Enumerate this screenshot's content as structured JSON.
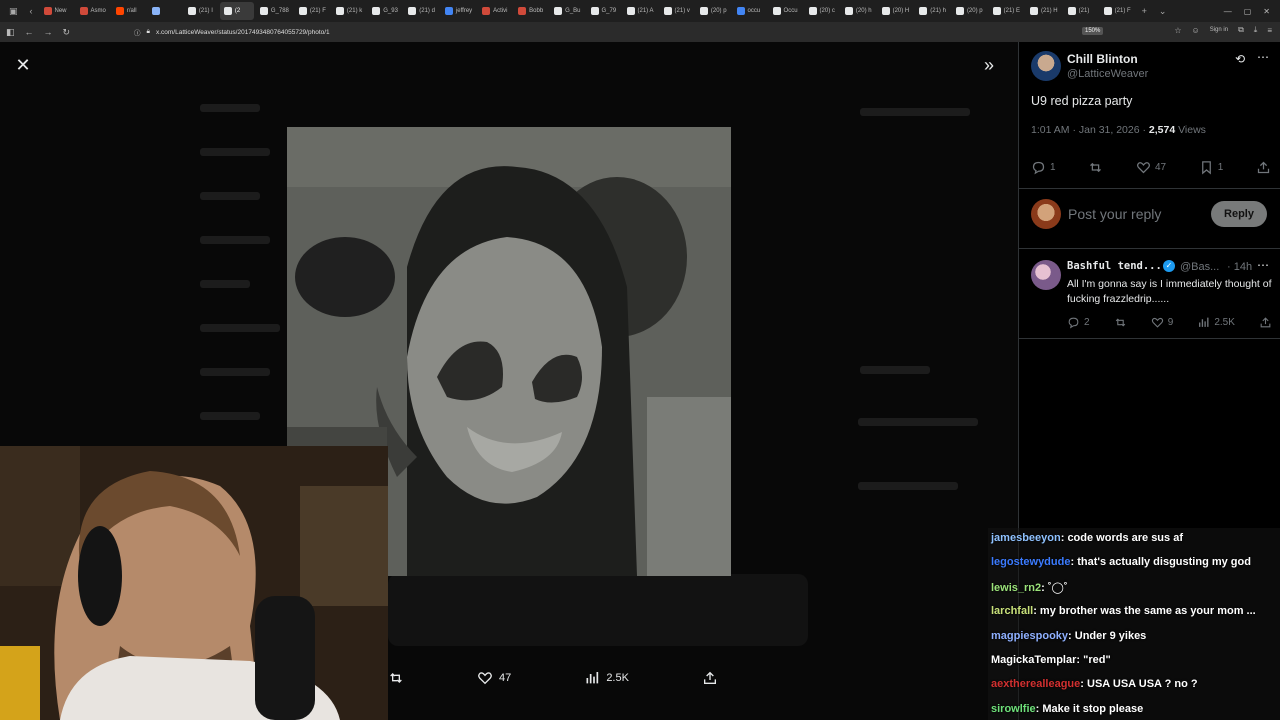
{
  "browser": {
    "tabs": [
      {
        "label": "New",
        "color": "#d04a3a"
      },
      {
        "label": "Asmo",
        "color": "#d04a3a"
      },
      {
        "label": "r/all",
        "color": "#ff4500"
      },
      {
        "label": "",
        "color": "#8ab4f8"
      },
      {
        "label": "(21) I",
        "color": "#e7e9ea"
      },
      {
        "label": "(2",
        "color": "#e7e9ea"
      },
      {
        "label": "G_788",
        "color": "#e7e9ea"
      },
      {
        "label": "(21) F",
        "color": "#e7e9ea"
      },
      {
        "label": "(21) k",
        "color": "#e7e9ea"
      },
      {
        "label": "G_93",
        "color": "#e7e9ea"
      },
      {
        "label": "(21) d",
        "color": "#e7e9ea"
      },
      {
        "label": "jeffrey",
        "color": "#4285f4"
      },
      {
        "label": "Activi",
        "color": "#d04a3a"
      },
      {
        "label": "Bobb",
        "color": "#d04a3a"
      },
      {
        "label": "G_Bu",
        "color": "#e7e9ea"
      },
      {
        "label": "G_79",
        "color": "#e7e9ea"
      },
      {
        "label": "(21) A",
        "color": "#e7e9ea"
      },
      {
        "label": "(21) v",
        "color": "#e7e9ea"
      },
      {
        "label": "(20) p",
        "color": "#e7e9ea"
      },
      {
        "label": "occu",
        "color": "#4285f4"
      },
      {
        "label": "Occu",
        "color": "#e7e9ea"
      },
      {
        "label": "(20) c",
        "color": "#e7e9ea"
      },
      {
        "label": "(20) h",
        "color": "#e7e9ea"
      },
      {
        "label": "(20) H",
        "color": "#e7e9ea"
      },
      {
        "label": "(21) h",
        "color": "#e7e9ea"
      },
      {
        "label": "(20) p",
        "color": "#e7e9ea"
      },
      {
        "label": "(21) E",
        "color": "#e7e9ea"
      },
      {
        "label": "(21) H",
        "color": "#e7e9ea"
      },
      {
        "label": "(21)",
        "color": "#e7e9ea"
      },
      {
        "label": "(21) F",
        "color": "#e7e9ea"
      }
    ],
    "url": "x.com/LatticeWeaver/status/2017493480764055729/photo/1",
    "zoom": "150%",
    "sign_in": "Sign in"
  },
  "lightbox": {
    "actions": {
      "likes": "47",
      "views": "2.5K"
    }
  },
  "post": {
    "author_name": "Chill Blinton",
    "author_handle": "@LatticeWeaver",
    "text": "U9 red pizza party",
    "time": "1:01 AM · Jan 31, 2026 · ",
    "views_count": "2,574",
    "views_label": " Views",
    "replies": "1",
    "likes": "47",
    "bookmarks": "1",
    "reply_placeholder": "Post your reply",
    "reply_button": "Reply"
  },
  "comment": {
    "name": "Bashful tend...",
    "handle": "@Bas...",
    "time": "· 14h",
    "text": "All I'm gonna say is I immediately thought of fucking frazzledrip......",
    "replies": "2",
    "likes": "9",
    "views": "2.5K"
  },
  "chat": [
    {
      "user": "jamesbeeyon",
      "color": "#8fc2ff",
      "msg": "code words are sus af"
    },
    {
      "user": "legostewydude",
      "color": "#3b7bff",
      "msg": "that's actually disgusting my god"
    },
    {
      "user": "lewis_rn2",
      "color": "#9be37a",
      "msg": "˚◯˚"
    },
    {
      "user": "larchfall",
      "color": "#c8e07a",
      "msg": "my brother was the same as your mom ..."
    },
    {
      "user": "magpiespooky",
      "color": "#8fb0ff",
      "msg": "Under 9 yikes"
    },
    {
      "user": "MagickaTemplar",
      "color": "#ffffff",
      "msg": "\"red\""
    },
    {
      "user": "aextherealleague",
      "color": "#d23030",
      "msg": "USA USA USA ? no ?"
    },
    {
      "user": "sirowlfie",
      "color": "#6ee07a",
      "msg": "Make it stop please"
    }
  ]
}
